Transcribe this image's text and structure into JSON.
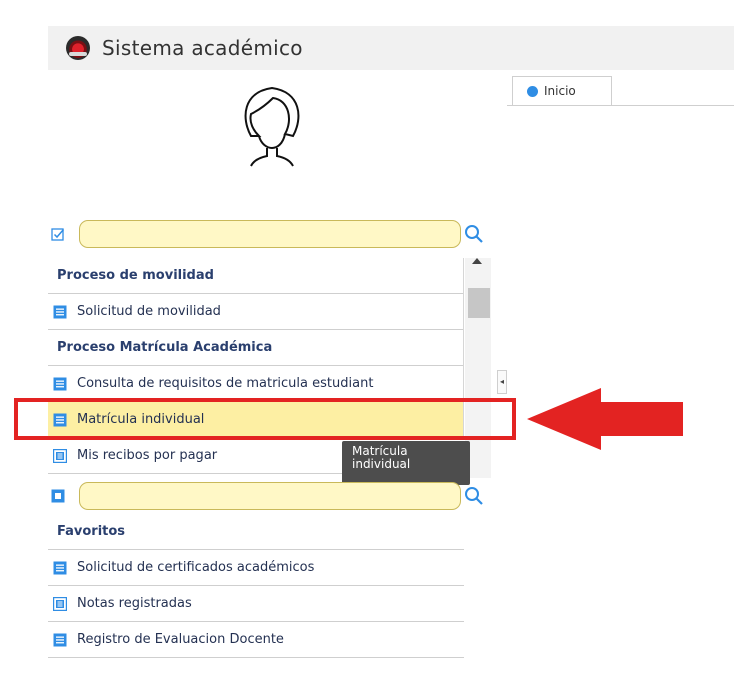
{
  "app": {
    "title": "Sistema académico"
  },
  "tabs": [
    {
      "label": "Inicio"
    }
  ],
  "menu_search": {
    "value": "",
    "placeholder": ""
  },
  "menu": {
    "items": [
      {
        "type": "header",
        "label": "Proceso de movilidad"
      },
      {
        "type": "item",
        "label": "Solicitud de movilidad",
        "icon": "list-icon"
      },
      {
        "type": "header",
        "label": "Proceso Matrícula Académica"
      },
      {
        "type": "item",
        "label": "Consulta de requisitos de matricula estudiant",
        "icon": "list-icon"
      },
      {
        "type": "item",
        "label": "Matrícula individual",
        "icon": "list-icon",
        "selected": true
      },
      {
        "type": "item",
        "label": "Mis recibos por pagar",
        "icon": "document-icon"
      }
    ]
  },
  "tooltip": {
    "line1": "Matrícula",
    "line2": "individual"
  },
  "favorites_search": {
    "value": "",
    "placeholder": ""
  },
  "favorites": {
    "title": "Favoritos",
    "items": [
      {
        "label": "Solicitud de certificados académicos",
        "icon": "list-icon"
      },
      {
        "label": "Notas registradas",
        "icon": "document-icon"
      },
      {
        "label": "Registro de Evaluacion Docente",
        "icon": "list-icon"
      }
    ]
  },
  "colors": {
    "accent": "#2f8de4",
    "highlight": "#e32322",
    "selected_row": "#fdefa3",
    "input_bg": "#fff8c6"
  }
}
